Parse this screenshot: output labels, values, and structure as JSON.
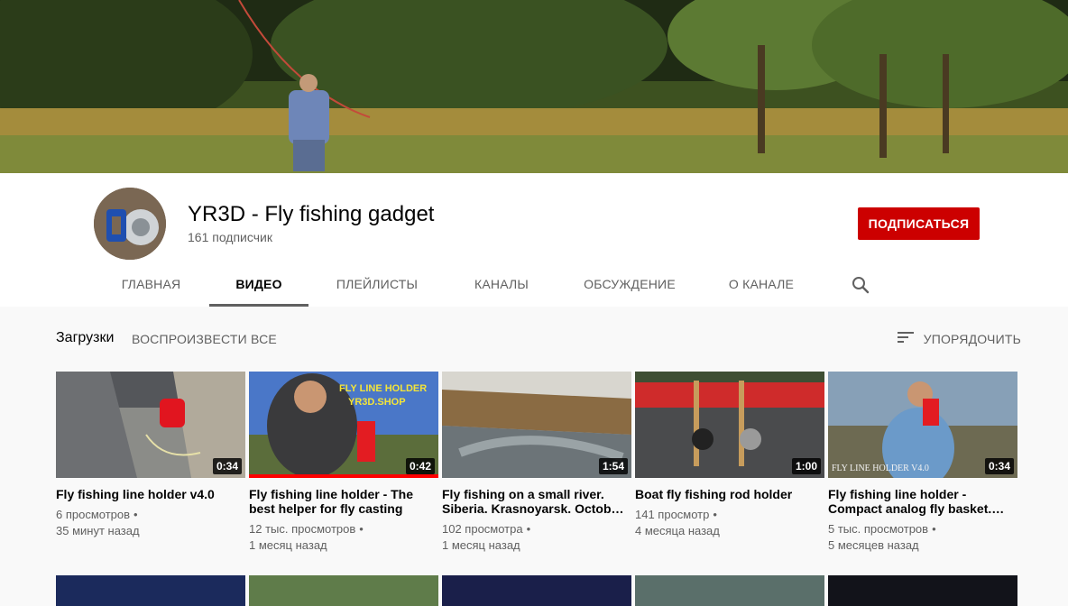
{
  "channel": {
    "title": "YR3D - Fly fishing gadget",
    "subscribers": "161 подписчик",
    "subscribe_label": "ПОДПИСАТЬСЯ"
  },
  "tabs": [
    {
      "label": "ГЛАВНАЯ",
      "active": false
    },
    {
      "label": "ВИДЕО",
      "active": true
    },
    {
      "label": "ПЛЕЙЛИСТЫ",
      "active": false
    },
    {
      "label": "КАНАЛЫ",
      "active": false
    },
    {
      "label": "ОБСУЖДЕНИЕ",
      "active": false
    },
    {
      "label": "О КАНАЛЕ",
      "active": false
    }
  ],
  "section": {
    "title": "Загрузки",
    "play_all": "ВОСПРОИЗВЕСТИ ВСЕ",
    "sort_label": "УПОРЯДОЧИТЬ"
  },
  "videos": [
    {
      "title": "Fly fishing line holder v4.0",
      "duration": "0:34",
      "views": "6 просмотров",
      "age": "35 минут назад",
      "progress": 0
    },
    {
      "title": "Fly fishing line holder - The best helper for fly casting",
      "duration": "0:42",
      "views": "12 тыс. просмотров",
      "age": "1 месяц назад",
      "progress": 1.0,
      "overlay1": "FLY LINE HOLDER",
      "overlay2": "YR3D.SHOP"
    },
    {
      "title": "Fly fishing on a small river. Siberia. Krasnoyarsk. Octob…",
      "duration": "1:54",
      "views": "102 просмотра",
      "age": "1 месяц назад",
      "progress": 0
    },
    {
      "title": "Boat fly fishing rod holder",
      "duration": "1:00",
      "views": "141 просмотр",
      "age": "4 месяца назад",
      "progress": 0
    },
    {
      "title": "Fly fishing line holder - Compact analog fly basket.…",
      "duration": "0:34",
      "views": "5 тыс. просмотров",
      "age": "5 месяцев назад",
      "progress": 0,
      "overlay1": "FLY LINE HOLDER V4.0"
    }
  ],
  "colors": {
    "subscribe": "#cc0000",
    "progress": "#ff0000",
    "text_primary": "#030303",
    "text_secondary": "#606060"
  }
}
